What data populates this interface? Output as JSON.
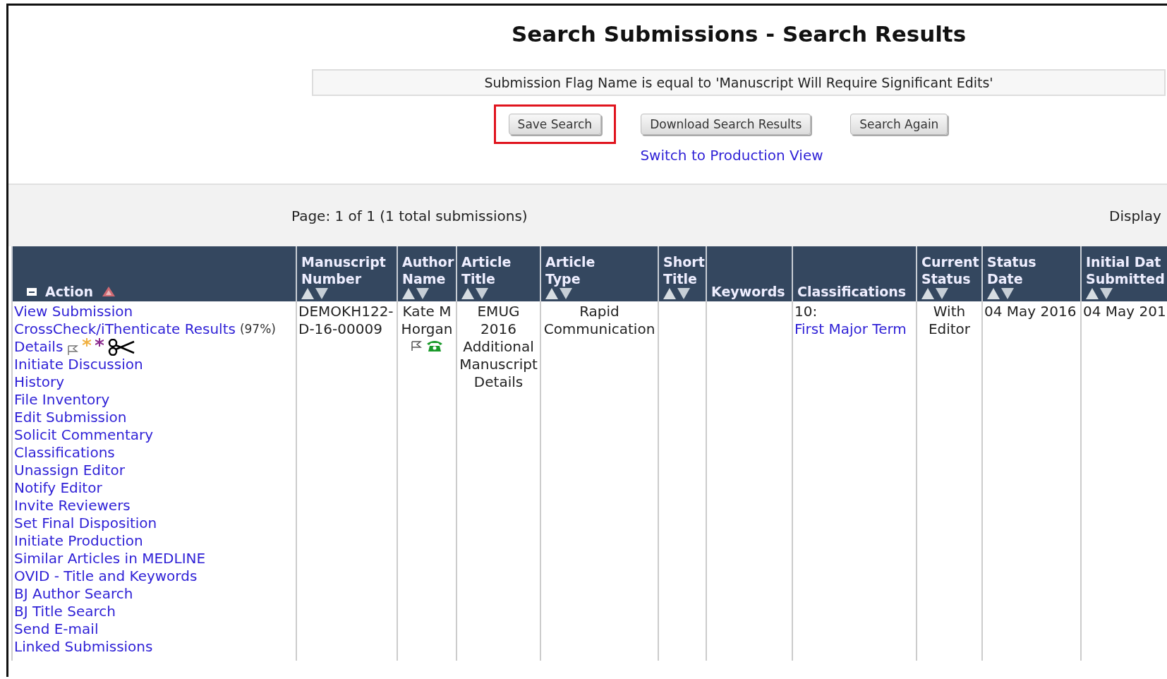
{
  "title": "Search Submissions - Search Results",
  "criteria": "Submission Flag Name is equal to 'Manuscript Will Require Significant Edits'",
  "buttons": [
    {
      "label": "Save Search",
      "highlighted": true
    },
    {
      "label": "Download Search Results",
      "highlighted": false
    },
    {
      "label": "Search Again",
      "highlighted": false
    }
  ],
  "view_link": "Switch to Production View",
  "pager": {
    "text": "Page: 1 of 1 (1 total submissions)",
    "display_label": "Display"
  },
  "columns": [
    {
      "label": "Action",
      "sortable": true,
      "sorted": true,
      "collapsible": true
    },
    {
      "label": "Manuscript Number",
      "sortable": true,
      "sorted": false,
      "collapsible": false
    },
    {
      "label": "Author Name",
      "sortable": true,
      "sorted": false,
      "collapsible": false
    },
    {
      "label": "Article Title",
      "sortable": true,
      "sorted": false,
      "collapsible": false
    },
    {
      "label": "Article Type",
      "sortable": true,
      "sorted": false,
      "collapsible": false
    },
    {
      "label": "Short Title",
      "sortable": true,
      "sorted": false,
      "collapsible": false
    },
    {
      "label": "Keywords",
      "sortable": false,
      "sorted": false,
      "collapsible": false
    },
    {
      "label": "Classifications",
      "sortable": false,
      "sorted": false,
      "collapsible": false
    },
    {
      "label": "Current Status",
      "sortable": true,
      "sorted": false,
      "collapsible": false
    },
    {
      "label": "Status Date",
      "sortable": true,
      "sorted": false,
      "collapsible": false
    },
    {
      "label": "Initial Dat Submitted",
      "sortable": true,
      "sorted": false,
      "collapsible": false
    }
  ],
  "row": {
    "actions": [
      {
        "kind": "link",
        "label": "View Submission"
      },
      {
        "kind": "link",
        "label": "CrossCheck/iThenticate Results",
        "note": "(97%)"
      },
      {
        "kind": "details",
        "label": "Details"
      },
      {
        "kind": "link",
        "label": "Initiate Discussion"
      },
      {
        "kind": "link",
        "label": "History"
      },
      {
        "kind": "link",
        "label": "File Inventory"
      },
      {
        "kind": "link",
        "label": "Edit Submission"
      },
      {
        "kind": "link",
        "label": "Solicit Commentary"
      },
      {
        "kind": "link",
        "label": "Classifications"
      },
      {
        "kind": "link",
        "label": "Unassign Editor"
      },
      {
        "kind": "link",
        "label": "Notify Editor"
      },
      {
        "kind": "link",
        "label": "Invite Reviewers"
      },
      {
        "kind": "link",
        "label": "Set Final Disposition"
      },
      {
        "kind": "link",
        "label": "Initiate Production"
      },
      {
        "kind": "link",
        "label": "Similar Articles in MEDLINE"
      },
      {
        "kind": "link",
        "label": "OVID - Title and Keywords"
      },
      {
        "kind": "link",
        "label": "BJ Author Search"
      },
      {
        "kind": "link",
        "label": "BJ Title Search"
      },
      {
        "kind": "link",
        "label": "Send E-mail"
      },
      {
        "kind": "link",
        "label": "Linked Submissions"
      }
    ],
    "manuscript_number": "DEMOKH122-D-16-00009",
    "author": "Kate M Horgan",
    "article_title": "EMUG 2016 Additional Manuscript Details",
    "article_type": "Rapid Communication",
    "classification_code": "10:",
    "classification_link": "First Major Term",
    "current_status": "With Editor",
    "status_date": "04 May 2016",
    "initial_date": "04 May 201"
  }
}
